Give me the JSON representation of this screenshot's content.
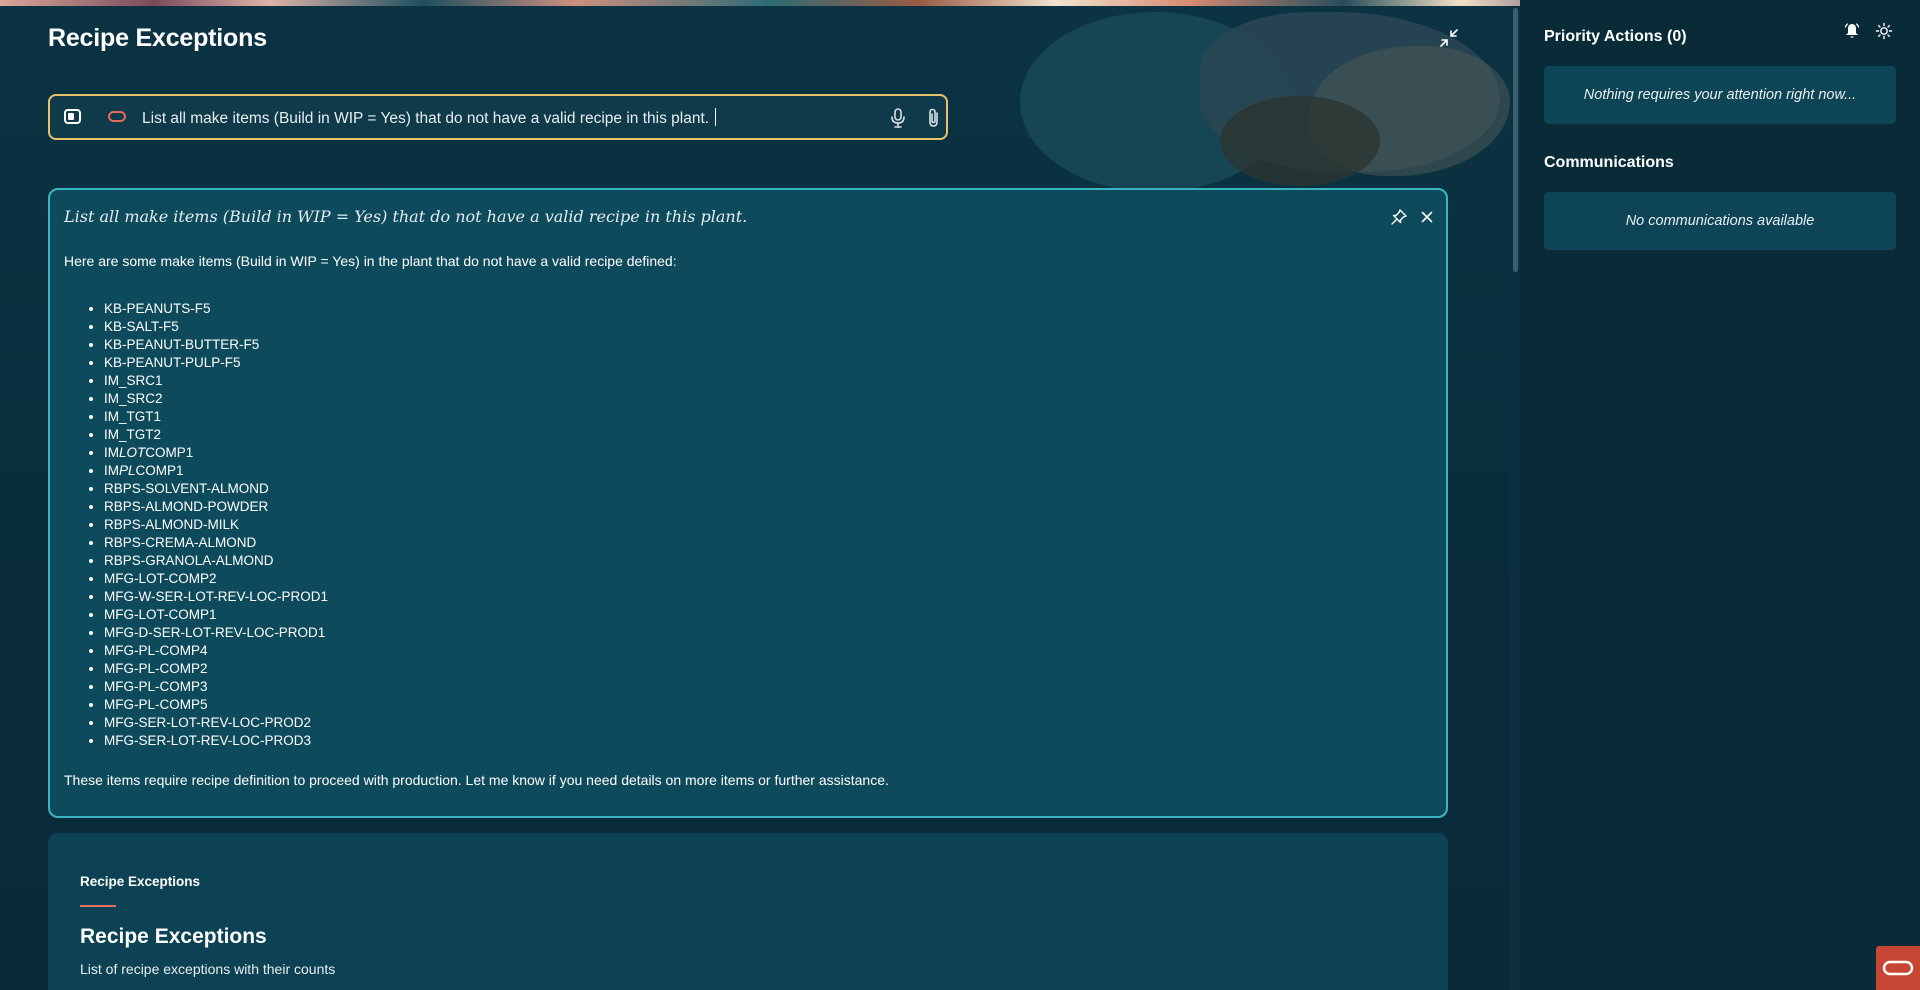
{
  "page": {
    "title": "Recipe Exceptions"
  },
  "search": {
    "query": "List all make items (Build in WIP = Yes) that do not have a valid recipe in this plant."
  },
  "response": {
    "question": "List all make items (Build in WIP = Yes) that do not have a valid recipe in this plant.",
    "intro": "Here are some make items (Build in WIP = Yes) in the plant that do not have a valid recipe defined:",
    "items": [
      {
        "parts": [
          {
            "t": "KB-PEANUTS-F5"
          }
        ]
      },
      {
        "parts": [
          {
            "t": "KB-SALT-F5"
          }
        ]
      },
      {
        "parts": [
          {
            "t": "KB-PEANUT-BUTTER-F5"
          }
        ]
      },
      {
        "parts": [
          {
            "t": "KB-PEANUT-PULP-F5"
          }
        ]
      },
      {
        "parts": [
          {
            "t": "IM_SRC1"
          }
        ]
      },
      {
        "parts": [
          {
            "t": "IM_SRC2"
          }
        ]
      },
      {
        "parts": [
          {
            "t": "IM_TGT1"
          }
        ]
      },
      {
        "parts": [
          {
            "t": "IM_TGT2"
          }
        ]
      },
      {
        "parts": [
          {
            "t": "IM"
          },
          {
            "t": "LOT",
            "i": true
          },
          {
            "t": "COMP1"
          }
        ]
      },
      {
        "parts": [
          {
            "t": "IM"
          },
          {
            "t": "PL",
            "i": true
          },
          {
            "t": "COMP1"
          }
        ]
      },
      {
        "parts": [
          {
            "t": "RBPS-SOLVENT-ALMOND"
          }
        ]
      },
      {
        "parts": [
          {
            "t": "RBPS-ALMOND-POWDER"
          }
        ]
      },
      {
        "parts": [
          {
            "t": "RBPS-ALMOND-MILK"
          }
        ]
      },
      {
        "parts": [
          {
            "t": "RBPS-CREMA-ALMOND"
          }
        ]
      },
      {
        "parts": [
          {
            "t": "RBPS-GRANOLA-ALMOND"
          }
        ]
      },
      {
        "parts": [
          {
            "t": "MFG-LOT-COMP2"
          }
        ]
      },
      {
        "parts": [
          {
            "t": "MFG-W-SER-LOT-REV-LOC-PROD1"
          }
        ]
      },
      {
        "parts": [
          {
            "t": "MFG-LOT-COMP1"
          }
        ]
      },
      {
        "parts": [
          {
            "t": "MFG-D-SER-LOT-REV-LOC-PROD1"
          }
        ]
      },
      {
        "parts": [
          {
            "t": "MFG-PL-COMP4"
          }
        ]
      },
      {
        "parts": [
          {
            "t": "MFG-PL-COMP2"
          }
        ]
      },
      {
        "parts": [
          {
            "t": "MFG-PL-COMP3"
          }
        ]
      },
      {
        "parts": [
          {
            "t": "MFG-PL-COMP5"
          }
        ]
      },
      {
        "parts": [
          {
            "t": "MFG-SER-LOT-REV-LOC-PROD2"
          }
        ]
      },
      {
        "parts": [
          {
            "t": "MFG-SER-LOT-REV-LOC-PROD3"
          }
        ]
      }
    ],
    "footer": "These items require recipe definition to proceed with production. Let me know if you need details on more items or further assistance."
  },
  "card": {
    "tab_label": "Recipe Exceptions",
    "title": "Recipe Exceptions",
    "subtitle": "List of recipe exceptions with their counts"
  },
  "sidebar": {
    "priority_title": "Priority Actions (0)",
    "priority_empty": "Nothing requires your attention right now...",
    "communications_title": "Communications",
    "communications_empty": "No communications available"
  },
  "colors": {
    "accent_border": "#e8c26b",
    "response_border": "#3bb3c2",
    "brand": "#c74634",
    "tab_underline": "#e0705b"
  },
  "icons": [
    "collapse-icon",
    "sidebar-toggle-icon",
    "ai-pill-icon",
    "microphone-icon",
    "paperclip-icon",
    "pin-icon",
    "close-icon",
    "bell-icon",
    "sun-icon",
    "oracle-logo-icon"
  ]
}
